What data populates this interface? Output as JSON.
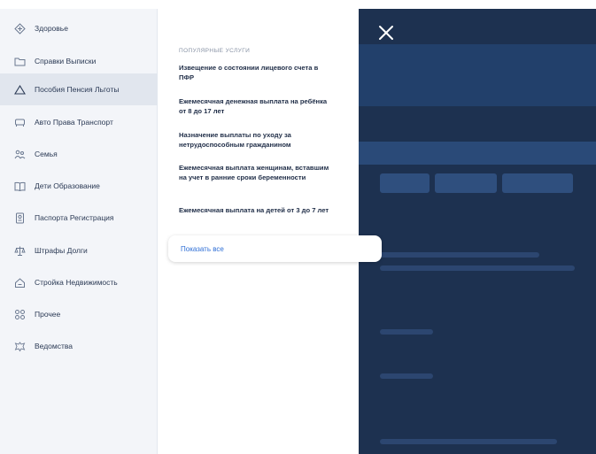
{
  "sidebar": {
    "items": [
      {
        "label": "Здоровье",
        "icon": "heart-icon",
        "active": false
      },
      {
        "label": "Справки Выписки",
        "icon": "folder-icon",
        "active": false
      },
      {
        "label": "Пособия Пенсия Льготы",
        "icon": "triangle-icon",
        "active": true
      },
      {
        "label": "Авто Права Транспорт",
        "icon": "car-icon",
        "active": false
      },
      {
        "label": "Семья",
        "icon": "family-icon",
        "active": false
      },
      {
        "label": "Дети Образование",
        "icon": "book-icon",
        "active": false
      },
      {
        "label": "Паспорта Регистрация",
        "icon": "passport-icon",
        "active": false
      },
      {
        "label": "Штрафы Долги",
        "icon": "scales-icon",
        "active": false
      },
      {
        "label": "Стройка Недвижимость",
        "icon": "house-icon",
        "active": false
      },
      {
        "label": "Прочее",
        "icon": "grid-icon",
        "active": false
      },
      {
        "label": "Ведомства",
        "icon": "emblem-icon",
        "active": false
      }
    ]
  },
  "panel": {
    "heading": "Популярные услуги",
    "services": [
      "Извещение о состоянии лицевого счета в ПФР",
      "Ежемесячная денежная выплата на ребёнка от 8 до 17 лет",
      "Назначение выплаты по уходу за нетрудоспособным гражданином",
      "Ежемесячная выплата женщинам, вставшим на учет в ранние сроки беременности",
      "Ежемесячная выплата на детей от 3 до 7 лет"
    ],
    "show_all": "Показать все"
  },
  "close_icon": "close-icon",
  "colors": {
    "accent": "#2f6fd6",
    "overlay": "#1d3150",
    "sidebar_bg": "#f3f5f9",
    "active_item": "#e1e6ee"
  }
}
